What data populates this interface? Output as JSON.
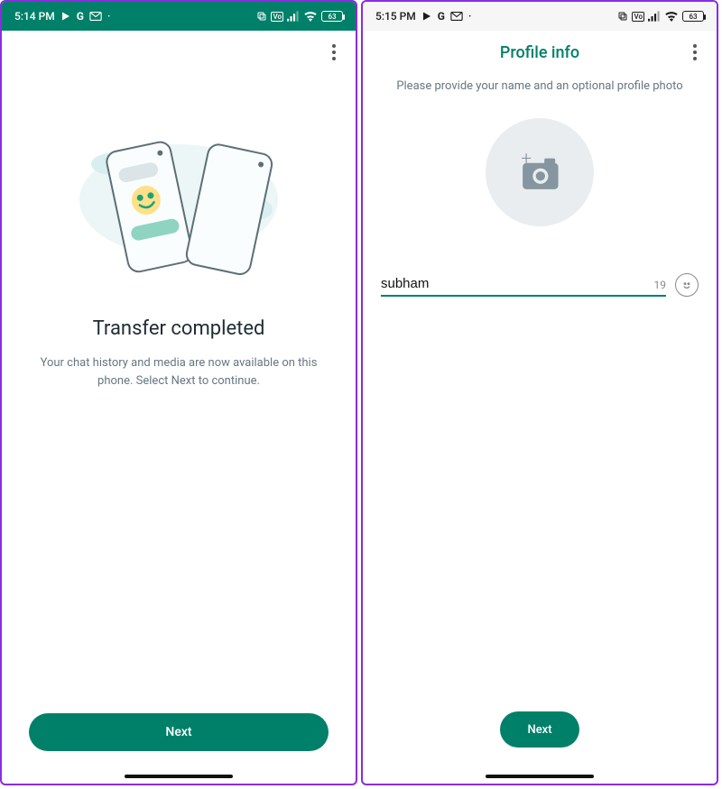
{
  "screens": {
    "left": {
      "statusbar": {
        "time": "5:14 PM",
        "battery": "63"
      },
      "headline": "Transfer completed",
      "subtext": "Your chat history and media are now available on this phone. Select Next to continue.",
      "next_label": "Next"
    },
    "right": {
      "statusbar": {
        "time": "5:15 PM",
        "battery": "63"
      },
      "title": "Profile info",
      "instruction": "Please provide your name and an optional profile photo",
      "name_value": "subham",
      "char_remaining": "19",
      "next_label": "Next"
    }
  }
}
